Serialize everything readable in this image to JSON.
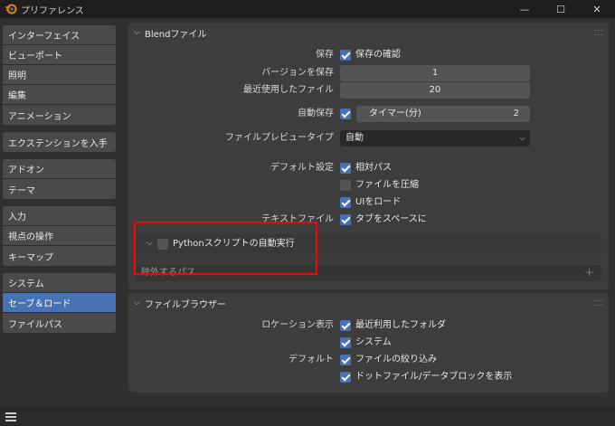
{
  "window": {
    "title": "プリファレンス",
    "controls": {
      "minimize": "—",
      "maximize": "☐",
      "close": "✕"
    }
  },
  "sidebar": {
    "groups": [
      {
        "items": [
          {
            "label": "インターフェイス"
          },
          {
            "label": "ビューポート"
          },
          {
            "label": "照明"
          },
          {
            "label": "編集"
          },
          {
            "label": "アニメーション"
          }
        ]
      },
      {
        "items": [
          {
            "label": "エクステンションを入手"
          }
        ]
      },
      {
        "items": [
          {
            "label": "アドオン"
          },
          {
            "label": "テーマ"
          }
        ]
      },
      {
        "items": [
          {
            "label": "入力"
          },
          {
            "label": "視点の操作"
          },
          {
            "label": "キーマップ"
          }
        ]
      },
      {
        "items": [
          {
            "label": "システム"
          },
          {
            "label": "セーブ＆ロード",
            "active": true
          },
          {
            "label": "ファイルパス"
          }
        ]
      }
    ]
  },
  "blend_panel": {
    "title": "Blendファイル",
    "save": {
      "label": "保存",
      "checkbox_label": "保存の確認",
      "checked": true
    },
    "save_versions": {
      "label": "バージョンを保存",
      "value": "1"
    },
    "recent_files": {
      "label": "最近使用したファイル",
      "value": "20"
    },
    "autosave": {
      "label": "自動保存",
      "checked": true,
      "timer_label": "タイマー(分)",
      "timer_value": "2"
    },
    "file_preview": {
      "label": "ファイルプレビュータイプ",
      "value": "自動"
    },
    "defaults": {
      "label": "デフォルト設定",
      "relative_paths": {
        "label": "相対パス",
        "checked": true
      },
      "compress": {
        "label": "ファイルを圧縮",
        "checked": false
      },
      "load_ui": {
        "label": "UIをロード",
        "checked": true
      }
    },
    "text_files": {
      "label": "テキストファイル",
      "tabs_as_spaces": {
        "label": "タブをスペースに",
        "checked": true
      }
    },
    "python_autoexec": {
      "label": "Pythonスクリプトの自動実行",
      "checked": false
    },
    "excluded_paths": {
      "label": "除外するパス",
      "add_icon": "＋"
    }
  },
  "browser_panel": {
    "title": "ファイルブラウザー",
    "location": {
      "label": "ロケーション表示",
      "recent_folders": {
        "label": "最近利用したフォルダ",
        "checked": true
      },
      "system": {
        "label": "システム",
        "checked": true
      }
    },
    "defaults": {
      "label": "デフォルト",
      "filter_files": {
        "label": "ファイルの絞り込み",
        "checked": true
      },
      "show_dotfiles": {
        "label": "ドットファイル/データブロックを表示",
        "checked": true
      }
    }
  },
  "colors": {
    "accent": "#4772b3",
    "highlight_box": "#ff0000",
    "logo_orange": "#e87d0d"
  }
}
